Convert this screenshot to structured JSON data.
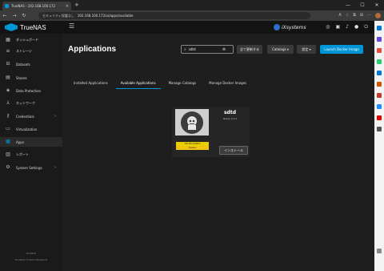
{
  "browser": {
    "tab_title": "TrueNAS - 192.168.100.172",
    "security_warning": "セキュリティ保護なし",
    "url": "192.168.100.172/ui/apps/available",
    "new_tab": "+",
    "minimize": "—",
    "maximize": "☐",
    "close": "✕"
  },
  "header": {
    "logo_text": "TrueNAS",
    "ix_text": "iXsystems"
  },
  "sidebar": {
    "items": [
      {
        "label": "ダッシュボード",
        "icon": "dashboard-icon",
        "glyph": "▦"
      },
      {
        "label": "ストレージ",
        "icon": "storage-icon",
        "glyph": "≡"
      },
      {
        "label": "Datasets",
        "icon": "datasets-icon",
        "glyph": "⊟"
      },
      {
        "label": "Shares",
        "icon": "shares-icon",
        "glyph": "▤"
      },
      {
        "label": "Data Protection",
        "icon": "shield-icon",
        "glyph": "◈"
      },
      {
        "label": "ネットワーク",
        "icon": "network-icon",
        "glyph": "⅄"
      },
      {
        "label": "Credentials",
        "icon": "key-icon",
        "glyph": "⚷"
      },
      {
        "label": "Virtualization",
        "icon": "laptop-icon",
        "glyph": "▭"
      },
      {
        "label": "Apps",
        "icon": "apps-icon",
        "glyph": "▦"
      },
      {
        "label": "レポート",
        "icon": "reports-icon",
        "glyph": "▥"
      },
      {
        "label": "System Settings",
        "icon": "gear-icon",
        "glyph": "⚙"
      }
    ],
    "footer_line1": "TrueNAS",
    "footer_line2": "TrueNAS ©2024 iXsystems"
  },
  "main": {
    "title": "Applications",
    "search_value": "sdtd",
    "btn_update_all": "全て更新する",
    "btn_catalogs": "Catalogs ▾",
    "btn_settings": "設定 ▾",
    "btn_launch": "Launch Docker Image",
    "tabs": [
      "Installed Applications",
      "Available Applications",
      "Manage Catalogs",
      "Manage Docker Images"
    ]
  },
  "card": {
    "name": "sdtd",
    "version": "latest_2.0.0",
    "badge_catalog": "TRUECHARTS",
    "badge_train": "Stable",
    "install_label": "インストール"
  },
  "colors": {
    "accent": "#0095d5",
    "badge": "#e8d000"
  }
}
